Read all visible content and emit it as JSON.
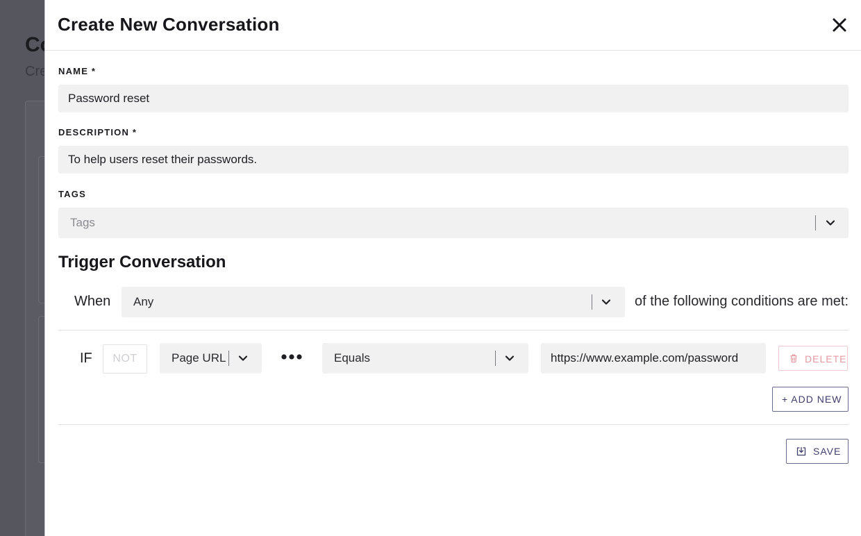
{
  "background": {
    "title": "Co",
    "subtitle": "Cre"
  },
  "modal": {
    "title": "Create New Conversation",
    "close_icon": "close-icon"
  },
  "form": {
    "name_label": "NAME *",
    "name_value": "Password reset",
    "description_label": "DESCRIPTION *",
    "description_value": "To help users reset their passwords.",
    "tags_label": "TAGS",
    "tags_placeholder": "Tags"
  },
  "trigger": {
    "section_title": "Trigger Conversation",
    "when_label": "When",
    "match_value": "Any",
    "conditions_text": "of the following conditions are met:",
    "rule": {
      "if_label": "IF",
      "not_label": "NOT",
      "field_value": "Page URL",
      "operator_value": "Equals",
      "url_value": "https://www.example.com/password",
      "delete_label": "DELETE"
    },
    "add_new_label": "+ ADD NEW"
  },
  "actions": {
    "save_label": "SAVE"
  },
  "colors": {
    "accent": "#3e3e6e",
    "danger": "#e49aa0",
    "field_bg": "#f1f1f2",
    "overlay": "#4f5058"
  }
}
